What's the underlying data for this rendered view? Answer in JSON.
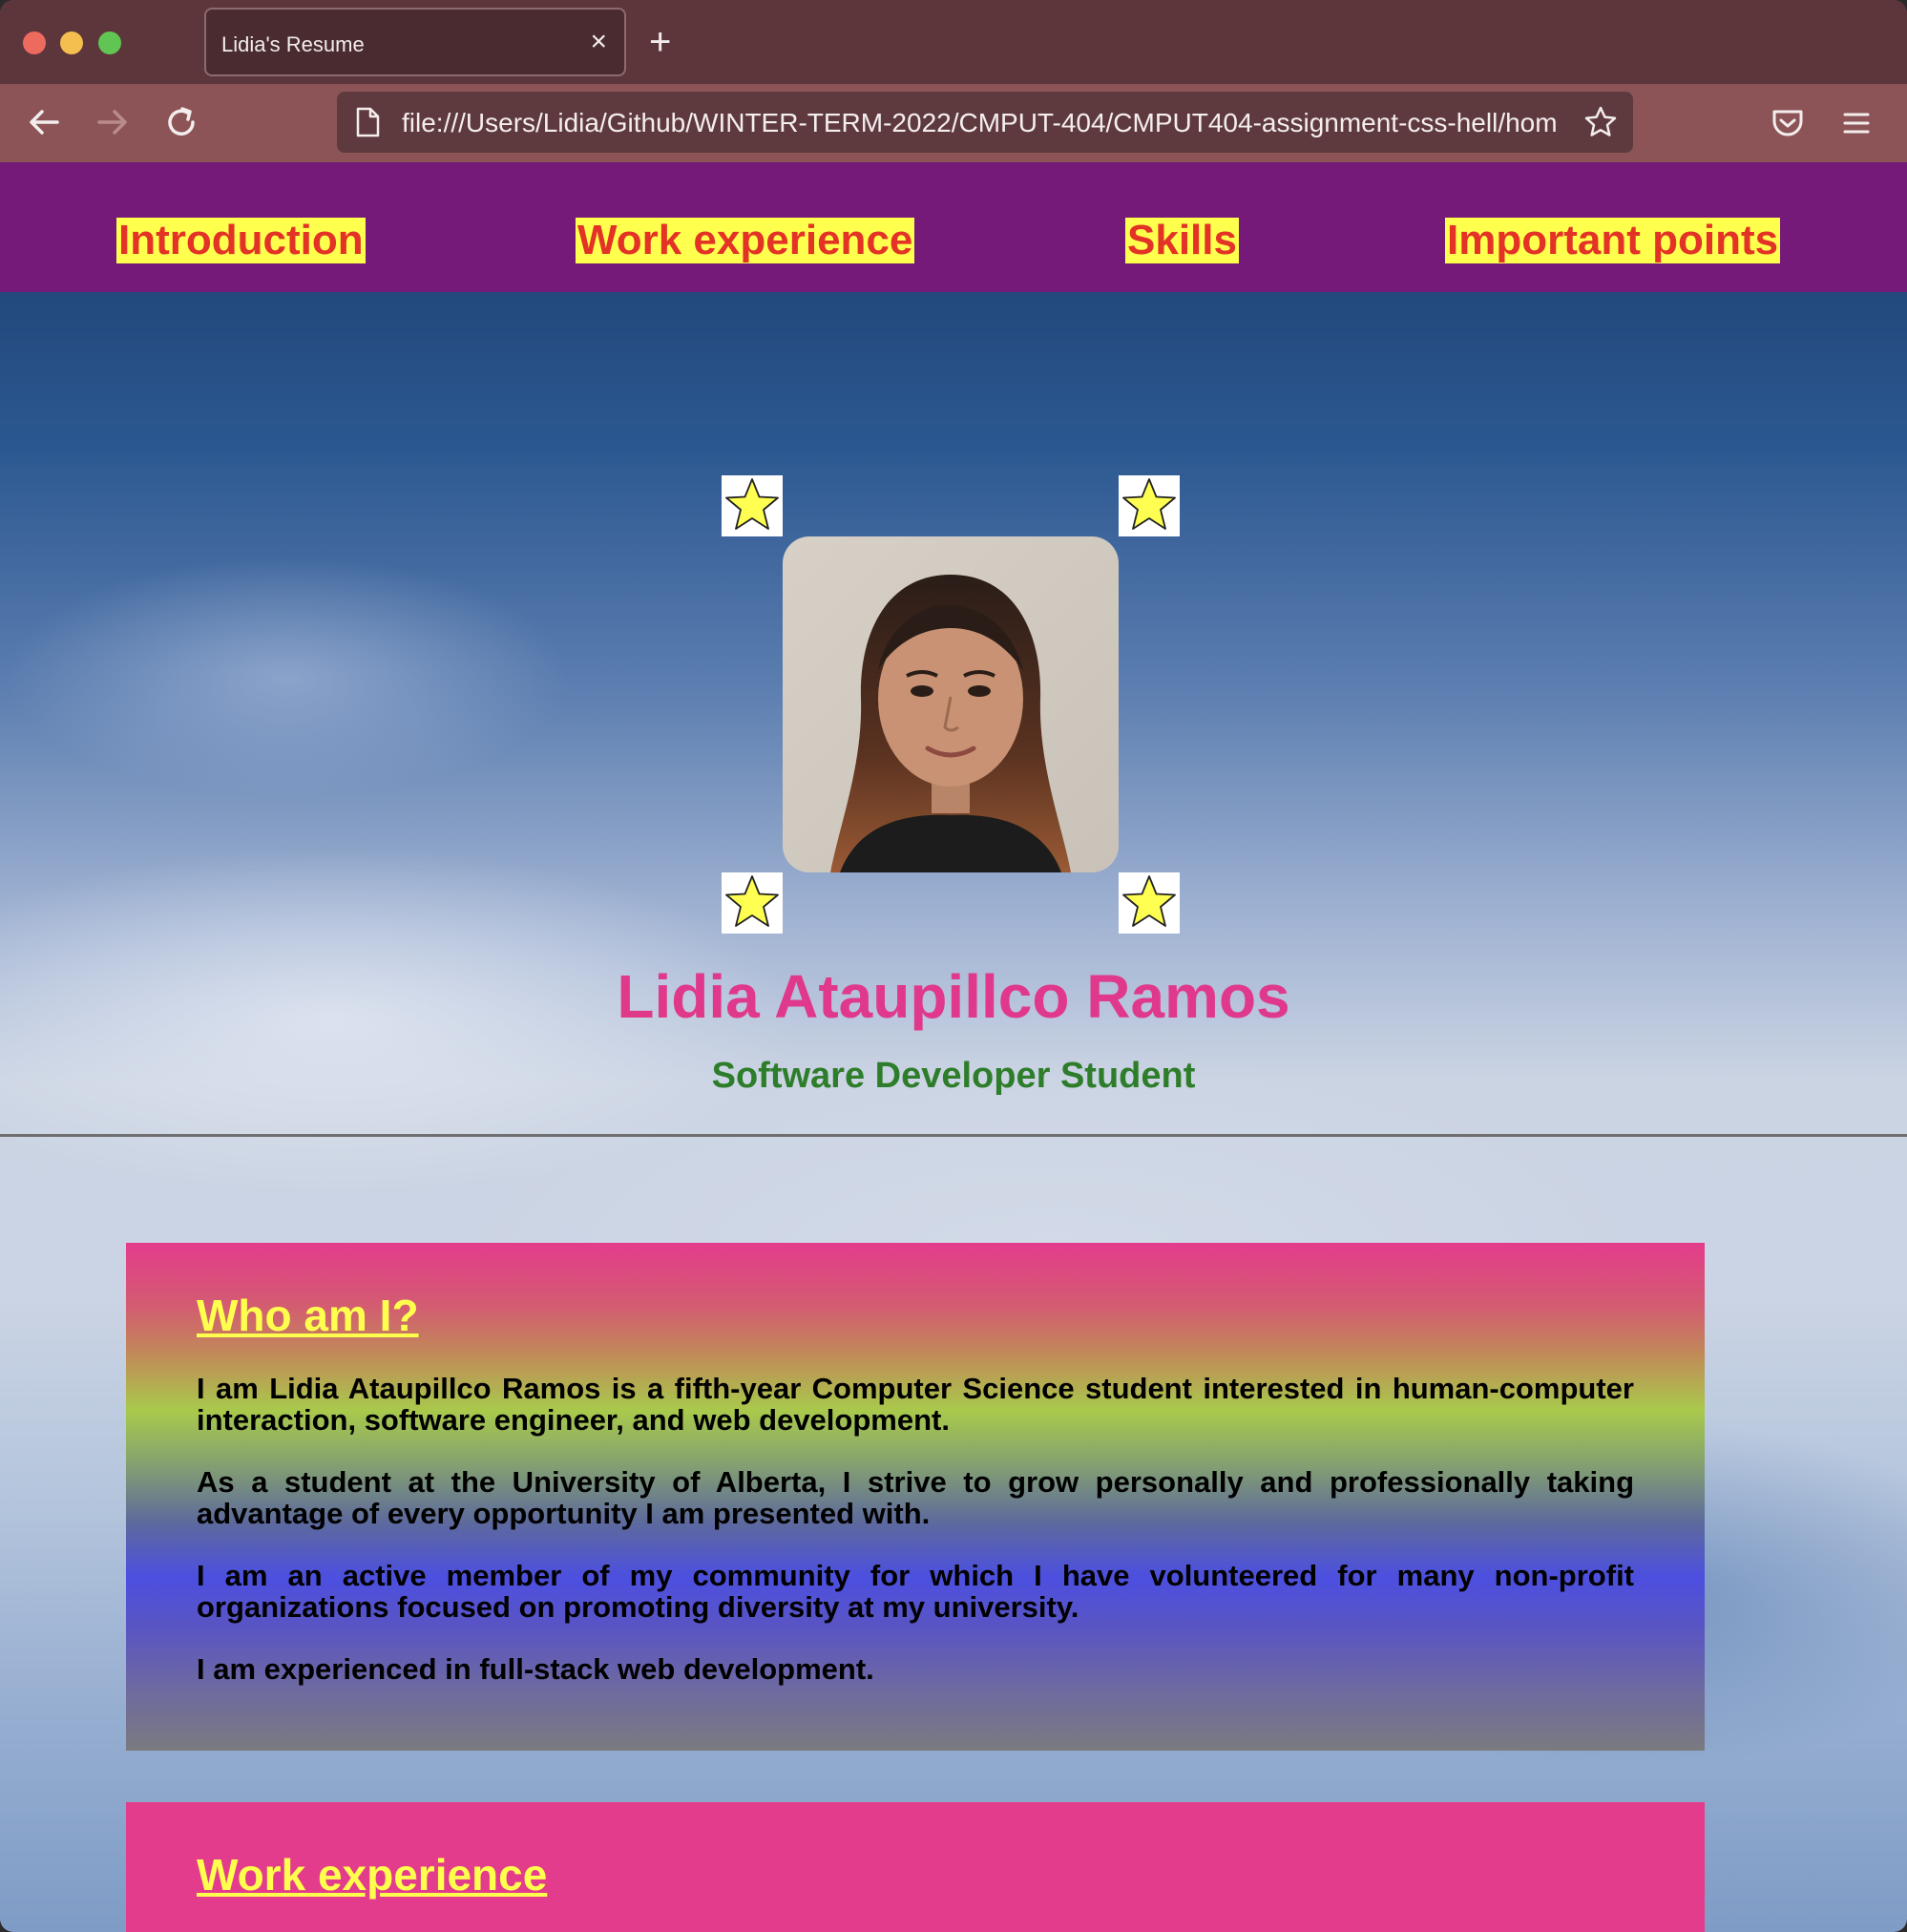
{
  "browser": {
    "tab_title": "Lidia's Resume",
    "tab_close": "×",
    "new_tab": "+",
    "url": "file:///Users/Lidia/Github/WINTER-TERM-2022/CMPUT-404/CMPUT404-assignment-css-hell/hom"
  },
  "nav": {
    "items": [
      {
        "label": "Introduction"
      },
      {
        "label": "Work experience"
      },
      {
        "label": "Skills"
      },
      {
        "label": "Important points"
      }
    ]
  },
  "header": {
    "name": "Lidia Ataupillco Ramos",
    "subtitle": "Software Developer Student"
  },
  "intro": {
    "heading": "Who am I?",
    "paragraphs": [
      "I am Lidia Ataupillco Ramos is a fifth-year Computer Science student interested in human-computer interaction, software engineer, and web development.",
      "As a student at the University of Alberta, I strive to grow personally and professionally taking advantage of every opportunity I am presented with.",
      "I am an active member of my community for which I have volunteered for many non-profit organizations focused on promoting diversity at my university.",
      "I am experienced in full-stack web development."
    ]
  },
  "work": {
    "heading": "Work experience"
  },
  "colors": {
    "nav_bg": "#761a79",
    "nav_link_bg": "#ffff4d",
    "nav_link_text": "#e33226",
    "name_color": "#e0398b",
    "subtitle_color": "#2e7d2a",
    "card_pink": "#e33c8c",
    "heading_yellow": "#ffff4d"
  },
  "icons": {
    "back": "arrow-left-icon",
    "forward": "arrow-right-icon",
    "reload": "reload-icon",
    "page": "file-icon",
    "bookmark": "star-outline-icon",
    "pocket": "pocket-icon",
    "menu": "hamburger-menu-icon",
    "decor": "yellow-star-icon"
  }
}
